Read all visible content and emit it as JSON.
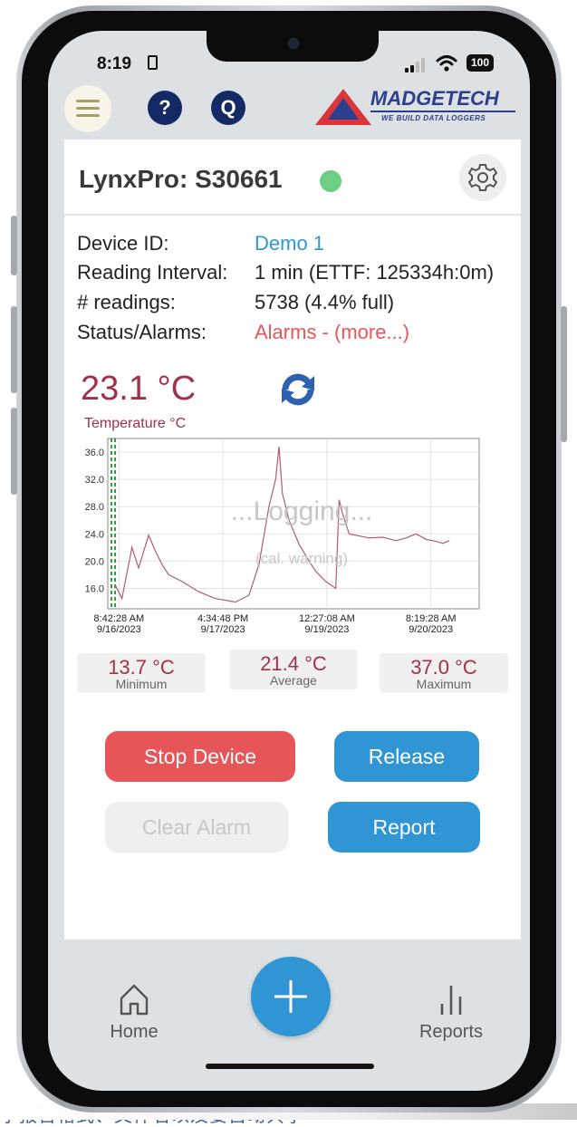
{
  "status_bar": {
    "time": "8:19",
    "battery": "100"
  },
  "header": {
    "help_label": "?",
    "q_label": "Q",
    "logo_name": "MADGETECH",
    "logo_tagline": "WE BUILD DATA LOGGERS"
  },
  "device": {
    "title": "LynxPro: S30661",
    "status_color": "#6dcf84",
    "info": [
      {
        "label": "Device ID:",
        "value": "Demo 1",
        "color": "#2f95d4"
      },
      {
        "label": "Reading Interval:",
        "value": "1 min (ETTF: 125334h:0m)",
        "color": "#222222"
      },
      {
        "label": "# readings:",
        "value": "5738 (4.4% full)",
        "color": "#222222"
      },
      {
        "label": "Status/Alarms:",
        "value": "Alarms - (more...)",
        "color": "#e65658"
      }
    ],
    "current_temp": "23.1 °C"
  },
  "chart_data": {
    "type": "line",
    "title": "Temperature °C",
    "overlay": "...Logging...",
    "overlay_sub": "(cal. warning)",
    "yticks": [
      "36.0",
      "32.0",
      "28.0",
      "24.0",
      "20.0",
      "16.0"
    ],
    "ylim": [
      13,
      38
    ],
    "xticks": [
      {
        "time": "8:42:28 AM",
        "date": "9/16/2023"
      },
      {
        "time": "4:34:48 PM",
        "date": "9/17/2023"
      },
      {
        "time": "12:27:08 AM",
        "date": "9/19/2023"
      },
      {
        "time": "8:19:28 AM",
        "date": "9/20/2023"
      }
    ],
    "x": [
      0,
      0.02,
      0.05,
      0.07,
      0.1,
      0.12,
      0.14,
      0.16,
      0.2,
      0.25,
      0.3,
      0.36,
      0.4,
      0.43,
      0.46,
      0.48,
      0.49,
      0.5,
      0.52,
      0.55,
      0.58,
      0.6,
      0.63,
      0.66,
      0.67,
      0.68,
      0.69,
      0.7,
      0.72,
      0.76,
      0.8,
      0.84,
      0.87,
      0.9,
      0.93,
      0.96,
      0.98,
      1.0
    ],
    "y": [
      16.5,
      14.5,
      22.0,
      19.0,
      23.8,
      21.5,
      19.5,
      18.0,
      17.0,
      15.5,
      14.5,
      14.0,
      15.0,
      19.5,
      28.0,
      32.0,
      36.8,
      30.0,
      26.0,
      22.5,
      20.0,
      18.5,
      17.0,
      16.0,
      29.0,
      27.0,
      25.5,
      24.0,
      23.8,
      23.4,
      23.5,
      23.0,
      23.4,
      24.0,
      23.2,
      22.9,
      22.6,
      23.0
    ],
    "series_color": "#b35a74",
    "marker_color": "#2aa33b",
    "minimum": {
      "value": "13.7 °C",
      "label": "Minimum"
    },
    "average": {
      "value": "21.4 °C",
      "label": "Average"
    },
    "maximum": {
      "value": "37.0 °C",
      "label": "Maximum"
    }
  },
  "actions": {
    "stop": "Stop Device",
    "release": "Release",
    "clear": "Clear Alarm",
    "report": "Report"
  },
  "tabbar": {
    "home": "Home",
    "reports": "Reports"
  },
  "caption": "字报告格式、文件名以及要自动共享"
}
